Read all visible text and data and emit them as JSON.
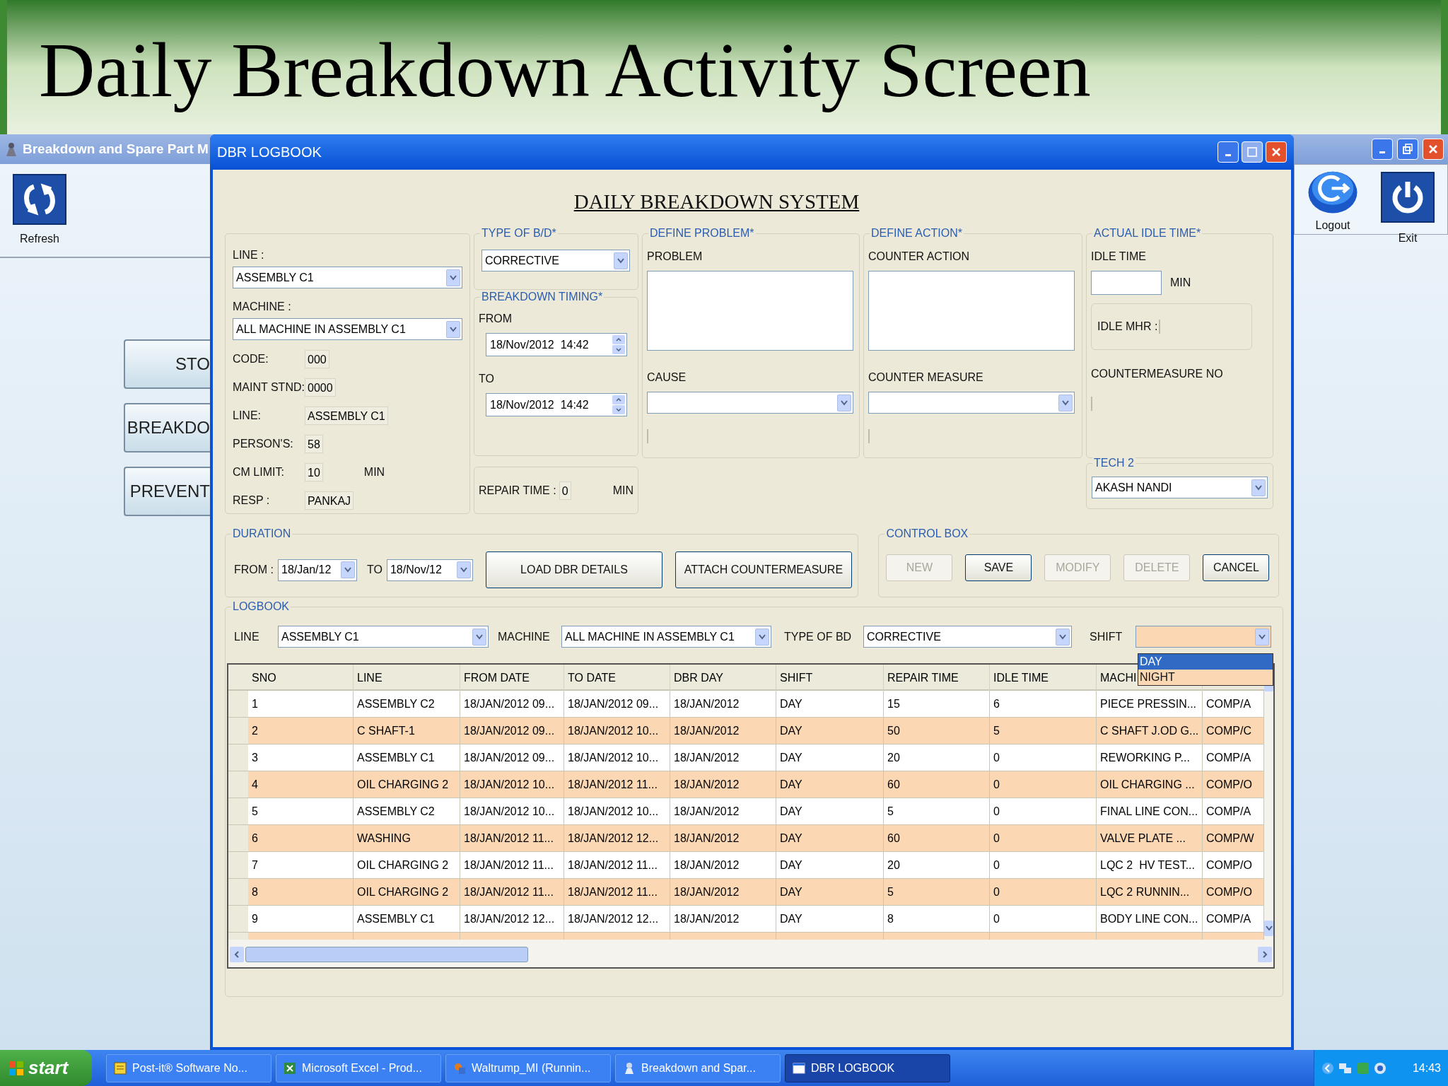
{
  "slide_title": "Daily Breakdown Activity Screen",
  "app_window": {
    "title": "Breakdown and Spare Part M",
    "tools_left": [
      "Refresh"
    ],
    "tools_right": [
      "Logout",
      "Exit"
    ],
    "side_buttons": [
      "STO",
      "BREAKDO",
      "PREVENT"
    ]
  },
  "dialog": {
    "title": "DBR LOGBOOK",
    "heading": "DAILY BREAKDOWN SYSTEM",
    "machine_info": {
      "line_label": "LINE :",
      "line_value": "ASSEMBLY C1",
      "machine_label": "MACHINE :",
      "machine_value": "ALL MACHINE IN ASSEMBLY C1",
      "fields": [
        {
          "label": "CODE:",
          "value": "000"
        },
        {
          "label": "MAINT STND:",
          "value": "0000"
        },
        {
          "label": "LINE:",
          "value": "ASSEMBLY C1"
        },
        {
          "label": "PERSON'S:",
          "value": "58"
        },
        {
          "label": "CM LIMIT:",
          "value": "10",
          "unit": "MIN"
        },
        {
          "label": "RESP :",
          "value": "PANKAJ"
        }
      ]
    },
    "type_of_bd": {
      "legend": "TYPE OF B/D*",
      "value": "CORRECTIVE"
    },
    "breakdown_timing": {
      "legend": "BREAKDOWN TIMING*",
      "from_label": "FROM",
      "from_value": "18/Nov/2012  14:42",
      "to_label": "TO",
      "to_value": "18/Nov/2012  14:42"
    },
    "repair_time": {
      "label": "REPAIR TIME :",
      "value": "0",
      "unit": "MIN"
    },
    "define_problem": {
      "legend": "DEFINE PROBLEM*",
      "problem_label": "PROBLEM",
      "cause_label": "CAUSE"
    },
    "define_action": {
      "legend": "DEFINE ACTION*",
      "counter_action_label": "COUNTER ACTION",
      "counter_measure_label": "COUNTER MEASURE"
    },
    "idle_time": {
      "legend": "ACTUAL IDLE TIME*",
      "idle_time_label": "IDLE TIME",
      "unit": "MIN",
      "idle_mhr_label": "IDLE MHR :",
      "countermeasure_no_label": "COUNTERMEASURE NO"
    },
    "tech2": {
      "legend": "TECH 2",
      "value": "AKASH NANDI"
    },
    "duration": {
      "legend": "DURATION",
      "from_label": "FROM :",
      "from_value": "18/Jan/12",
      "to_label": "TO",
      "to_value": "18/Nov/12",
      "buttons": [
        "LOAD DBR DETAILS",
        "ATTACH COUNTERMEASURE"
      ]
    },
    "control_box": {
      "legend": "CONTROL BOX",
      "buttons": [
        {
          "label": "NEW",
          "disabled": true
        },
        {
          "label": "SAVE",
          "disabled": false
        },
        {
          "label": "MODIFY",
          "disabled": true
        },
        {
          "label": "DELETE",
          "disabled": true
        },
        {
          "label": "CANCEL",
          "disabled": false
        }
      ]
    },
    "logbook": {
      "legend": "LOGBOOK",
      "filters": [
        {
          "label": "LINE",
          "value": "ASSEMBLY C1"
        },
        {
          "label": "MACHINE",
          "value": "ALL MACHINE IN ASSEMBLY C1"
        },
        {
          "label": "TYPE OF BD",
          "value": "CORRECTIVE"
        }
      ],
      "shift": {
        "label": "SHIFT",
        "options": [
          {
            "label": "DAY",
            "selected": true
          },
          {
            "label": "NIGHT",
            "selected": false
          }
        ]
      },
      "table": {
        "columns": [
          "SNO",
          "LINE",
          "FROM DATE",
          "TO DATE",
          "DBR DAY",
          "SHIFT",
          "REPAIR TIME",
          "IDLE TIME",
          "MACHI"
        ],
        "rows": [
          [
            "1",
            "ASSEMBLY C2",
            "18/JAN/2012 09...",
            "18/JAN/2012 09...",
            "18/JAN/2012",
            "DAY",
            "15",
            "6",
            "PIECE PRESSIN...",
            "COMP/A"
          ],
          [
            "2",
            "C SHAFT-1",
            "18/JAN/2012 09...",
            "18/JAN/2012 10...",
            "18/JAN/2012",
            "DAY",
            "50",
            "5",
            "C SHAFT J.OD G...",
            "COMP/C"
          ],
          [
            "3",
            "ASSEMBLY C1",
            "18/JAN/2012 09...",
            "18/JAN/2012 10...",
            "18/JAN/2012",
            "DAY",
            "20",
            "0",
            "REWORKING P...",
            "COMP/A"
          ],
          [
            "4",
            "OIL CHARGING 2",
            "18/JAN/2012 10...",
            "18/JAN/2012 11...",
            "18/JAN/2012",
            "DAY",
            "60",
            "0",
            "OIL CHARGING ...",
            "COMP/O"
          ],
          [
            "5",
            "ASSEMBLY C2",
            "18/JAN/2012 10...",
            "18/JAN/2012 10...",
            "18/JAN/2012",
            "DAY",
            "5",
            "0",
            "FINAL LINE CON...",
            "COMP/A"
          ],
          [
            "6",
            "WASHING",
            "18/JAN/2012 11...",
            "18/JAN/2012 12...",
            "18/JAN/2012",
            "DAY",
            "60",
            "0",
            "VALVE PLATE ...",
            "COMP/W"
          ],
          [
            "7",
            "OIL CHARGING 2",
            "18/JAN/2012 11...",
            "18/JAN/2012 11...",
            "18/JAN/2012",
            "DAY",
            "20",
            "0",
            "LQC 2  HV TEST...",
            "COMP/O"
          ],
          [
            "8",
            "OIL CHARGING 2",
            "18/JAN/2012 11...",
            "18/JAN/2012 11...",
            "18/JAN/2012",
            "DAY",
            "5",
            "0",
            "LQC 2 RUNNIN...",
            "COMP/O"
          ],
          [
            "9",
            "ASSEMBLY C1",
            "18/JAN/2012 12...",
            "18/JAN/2012 12...",
            "18/JAN/2012",
            "DAY",
            "8",
            "0",
            "BODY LINE CON...",
            "COMP/A"
          ]
        ]
      }
    }
  },
  "taskbar": {
    "start": "start",
    "items": [
      {
        "label": "Post-it® Software No...",
        "selected": false
      },
      {
        "label": "Microsoft Excel - Prod...",
        "selected": false
      },
      {
        "label": "Waltrump_MI (Runnin...",
        "selected": false
      },
      {
        "label": "Breakdown and Spar...",
        "selected": false
      },
      {
        "label": "DBR LOGBOOK",
        "selected": true
      }
    ],
    "clock": "14:43"
  }
}
